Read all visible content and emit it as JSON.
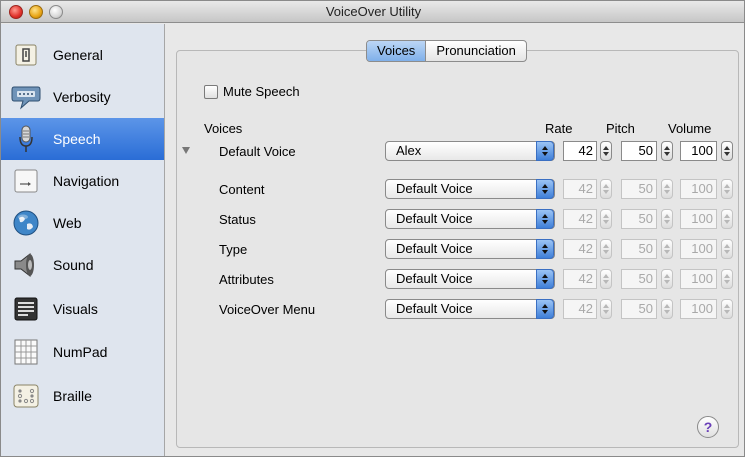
{
  "window": {
    "title": "VoiceOver Utility"
  },
  "sidebar": {
    "items": [
      {
        "label": "General",
        "icon": "general-icon"
      },
      {
        "label": "Verbosity",
        "icon": "verbosity-icon"
      },
      {
        "label": "Speech",
        "icon": "microphone-icon",
        "selected": true
      },
      {
        "label": "Navigation",
        "icon": "navigation-icon"
      },
      {
        "label": "Web",
        "icon": "globe-icon"
      },
      {
        "label": "Sound",
        "icon": "speaker-icon"
      },
      {
        "label": "Visuals",
        "icon": "visuals-icon"
      },
      {
        "label": "NumPad",
        "icon": "numpad-icon"
      },
      {
        "label": "Braille",
        "icon": "braille-icon"
      }
    ]
  },
  "tabs": [
    {
      "label": "Voices",
      "active": true
    },
    {
      "label": "Pronunciation",
      "active": false
    }
  ],
  "voices_panel": {
    "mute_label": "Mute Speech",
    "mute_checked": false,
    "headers": {
      "voices": "Voices",
      "rate": "Rate",
      "pitch": "Pitch",
      "volume": "Volume"
    },
    "rows": [
      {
        "label": "Default Voice",
        "voice": "Alex",
        "rate": "42",
        "pitch": "50",
        "volume": "100",
        "enabled": true
      },
      {
        "label": "Content",
        "voice": "Default Voice",
        "rate": "42",
        "pitch": "50",
        "volume": "100",
        "enabled": false
      },
      {
        "label": "Status",
        "voice": "Default Voice",
        "rate": "42",
        "pitch": "50",
        "volume": "100",
        "enabled": false
      },
      {
        "label": "Type",
        "voice": "Default Voice",
        "rate": "42",
        "pitch": "50",
        "volume": "100",
        "enabled": false
      },
      {
        "label": "Attributes",
        "voice": "Default Voice",
        "rate": "42",
        "pitch": "50",
        "volume": "100",
        "enabled": false
      },
      {
        "label": "VoiceOver Menu",
        "voice": "Default Voice",
        "rate": "42",
        "pitch": "50",
        "volume": "100",
        "enabled": false
      }
    ],
    "help_label": "?"
  },
  "colors": {
    "selection": "#2a6dd6",
    "help_glyph": "#6a3fb8"
  }
}
